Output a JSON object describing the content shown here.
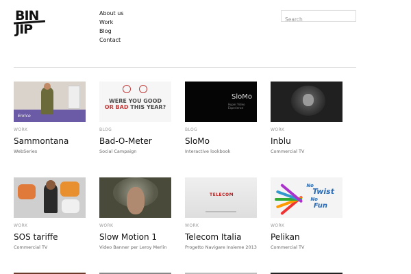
{
  "header": {
    "logo_line1": "BIN",
    "logo_line2": "JIP",
    "nav": [
      "About us",
      "Work",
      "Blog",
      "Contact"
    ]
  },
  "search": {
    "placeholder": "Search",
    "value": ""
  },
  "cards": [
    {
      "category": "WORK",
      "title": "Sammontana",
      "subtitle": "WebSeries"
    },
    {
      "category": "BLOG",
      "title": "Bad-O-Meter",
      "subtitle": "Social Campaign"
    },
    {
      "category": "BLOG",
      "title": "SloMo",
      "subtitle": "Interactive lookbook"
    },
    {
      "category": "WORK",
      "title": "Inblu",
      "subtitle": "Commercial TV"
    },
    {
      "category": "WORK",
      "title": "SOS tariffe",
      "subtitle": "Commercial TV"
    },
    {
      "category": "WORK",
      "title": "Slow Motion 1",
      "subtitle": "Video Banner per Leroy Merlin"
    },
    {
      "category": "WORK",
      "title": "Telecom Italia",
      "subtitle": "Progetto Navigare Insieme 2013"
    },
    {
      "category": "WORK",
      "title": "Pelikan",
      "subtitle": "Commercial TV"
    }
  ],
  "thumb_text": {
    "bad_line1": "WERE YOU GOOD",
    "bad_line2a": "OR BAD",
    "bad_line2b": "THIS YEAR?",
    "slomo_logo": "SloMo",
    "slomo_tag": "Hyper Video Experience",
    "sam_brand": "Enrico",
    "telecom_brand": "TELECOM",
    "pel_w1": "No",
    "pel_w2": "Twist",
    "pel_w3": "No",
    "pel_w4": "Fun"
  }
}
